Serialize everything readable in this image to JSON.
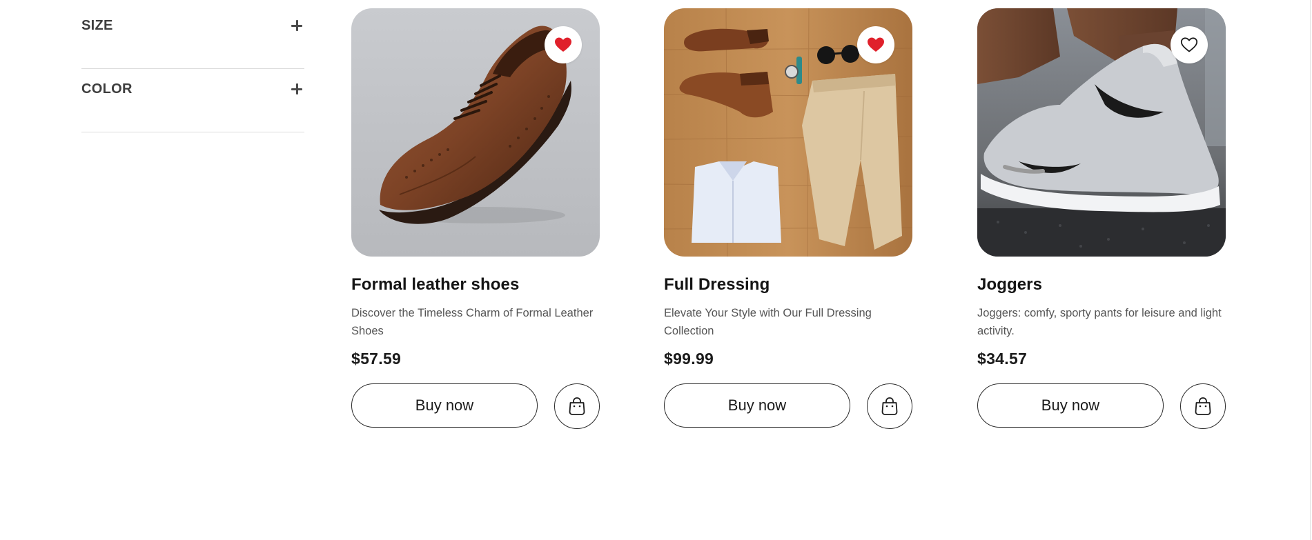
{
  "filters": {
    "items": [
      {
        "label": "SIZE"
      },
      {
        "label": "COLOR"
      }
    ]
  },
  "products": [
    {
      "title": "Formal leather shoes",
      "description": "Discover the Timeless Charm of Formal Leather Shoes",
      "price": "$57.59",
      "buy_label": "Buy now",
      "favorited": true,
      "image": "brown-brogue-shoe"
    },
    {
      "title": "Full Dressing",
      "description": "Elevate Your Style with Our Full Dressing Collection",
      "price": "$99.99",
      "buy_label": "Buy now",
      "favorited": true,
      "image": "flat-lay-outfit"
    },
    {
      "title": "Joggers",
      "description": "Joggers: comfy, sporty pants for leisure and light activity.",
      "price": "$34.57",
      "buy_label": "Buy now",
      "favorited": false,
      "image": "grey-sneaker-jogger"
    }
  ],
  "icons": {
    "favorite": "heart-icon",
    "cart": "shopping-bag-icon",
    "expand": "plus-icon"
  },
  "colors": {
    "favorite_active": "#e0202b",
    "text_primary": "#141414",
    "text_secondary": "#555555",
    "divider": "#dcdcdc"
  }
}
